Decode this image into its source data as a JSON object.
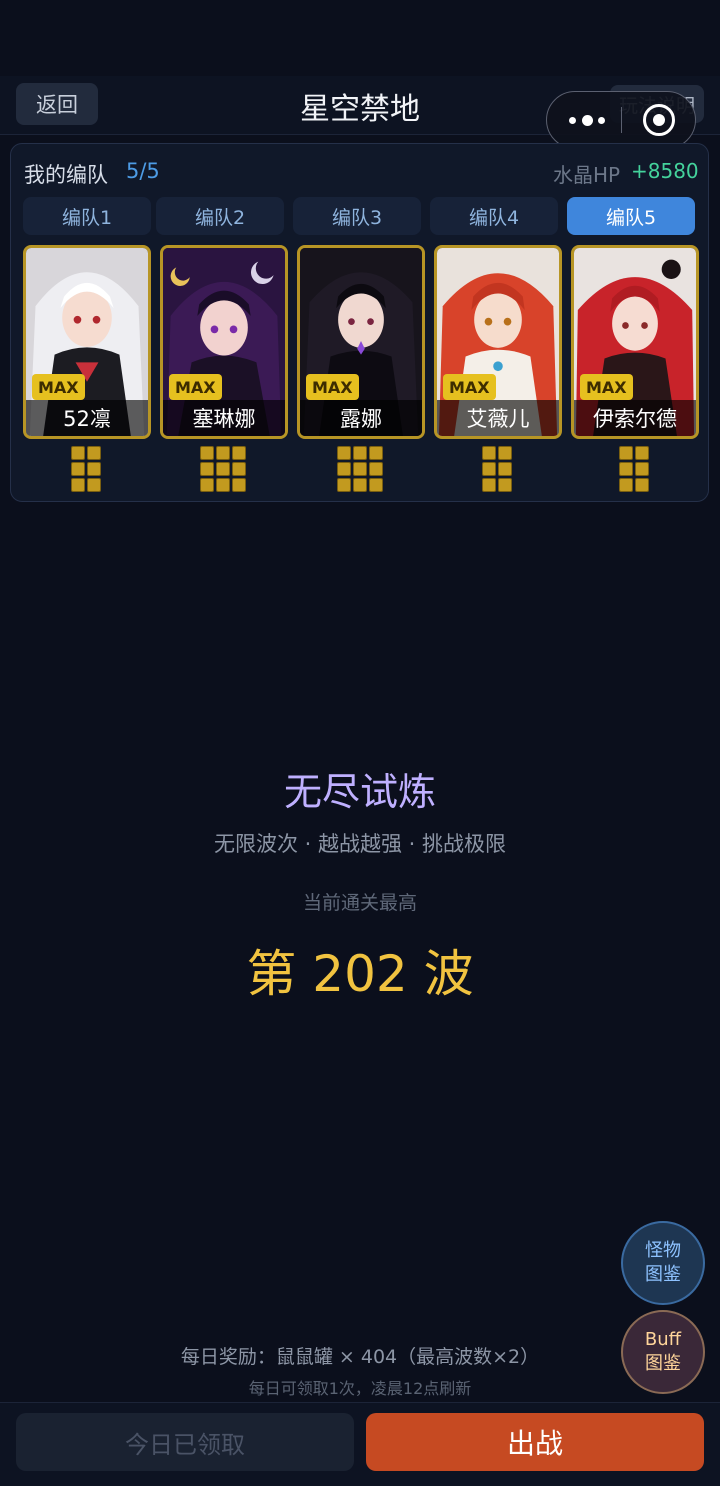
{
  "header": {
    "back_label": "返回",
    "title": "星空禁地",
    "rules_label": "玩法说明"
  },
  "team": {
    "label": "我的编队",
    "count": "5/5",
    "crystal_label": "水晶HP",
    "crystal_value": "+8580",
    "tabs": [
      "编队1",
      "编队2",
      "编队3",
      "编队4",
      "编队5"
    ],
    "active_tab_index": 4,
    "members": [
      {
        "name": "52凛",
        "level": "MAX"
      },
      {
        "name": "塞琳娜",
        "level": "MAX"
      },
      {
        "name": "露娜",
        "level": "MAX"
      },
      {
        "name": "艾薇儿",
        "level": "MAX"
      },
      {
        "name": "伊索尔德",
        "level": "MAX"
      }
    ]
  },
  "mode": {
    "title": "无尽试炼",
    "subtitle": "无限波次 · 越战越强 · 挑战极限",
    "best_label": "当前通关最高",
    "best_wave": "第 202 波"
  },
  "float_buttons": {
    "monster_line1": "怪物",
    "monster_line2": "图鉴",
    "buff_line1": "Buff",
    "buff_line2": "图鉴"
  },
  "reward": {
    "text": "每日奖励：鼠鼠罐 × 404（最高波数×2）",
    "note": "每日可领取1次，凌晨12点刷新"
  },
  "actions": {
    "claim_label": "今日已领取",
    "battle_label": "出战"
  },
  "colors": {
    "accent_blue": "#3f86dc",
    "gold": "#f1c340",
    "crystal_green": "#44d39c",
    "battle_orange": "#c64a22"
  }
}
